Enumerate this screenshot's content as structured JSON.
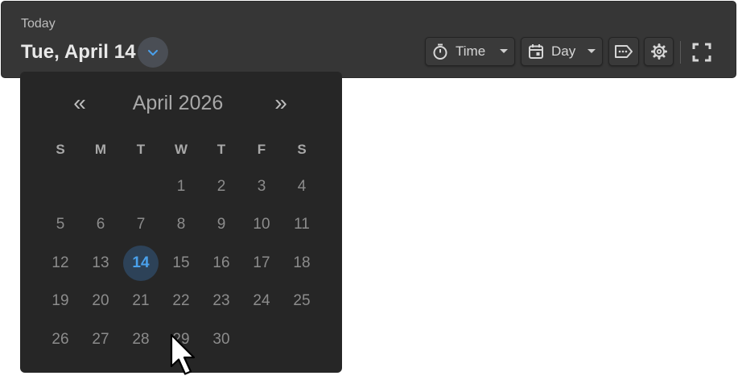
{
  "header": {
    "today_label": "Today",
    "date_title": "Tue, April 14",
    "time_button_label": "Time",
    "view_button_label": "Day"
  },
  "icons": {
    "toggle": "chevron-down-icon",
    "time": "stopwatch-icon",
    "view": "calendar-icon",
    "tags": "tag-icon",
    "settings": "gear-icon",
    "fullscreen": "fullscreen-icon"
  },
  "calendar": {
    "prev_label": "«",
    "next_label": "»",
    "month_title": "April 2026",
    "weekdays": [
      "S",
      "M",
      "T",
      "W",
      "T",
      "F",
      "S"
    ],
    "days": [
      "",
      "",
      "",
      "1",
      "2",
      "3",
      "4",
      "5",
      "6",
      "7",
      "8",
      "9",
      "10",
      "11",
      "12",
      "13",
      "14",
      "15",
      "16",
      "17",
      "18",
      "19",
      "20",
      "21",
      "22",
      "23",
      "24",
      "25",
      "26",
      "27",
      "28",
      "29",
      "30",
      "",
      ""
    ],
    "selected_day": "14"
  },
  "colors": {
    "topbar_bg": "#363636",
    "popup_bg": "#262626",
    "accent": "#4aa1ec",
    "selected_bg": "#2d4258"
  }
}
